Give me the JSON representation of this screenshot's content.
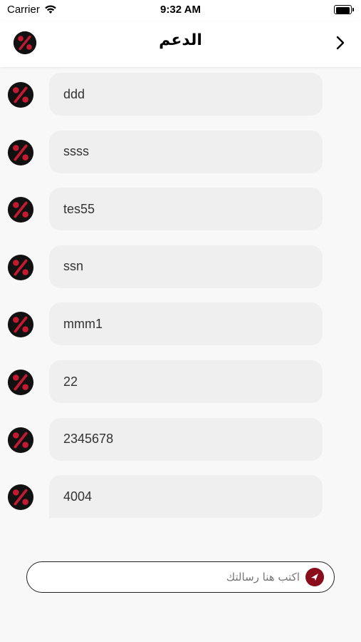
{
  "status_bar": {
    "carrier": "Carrier",
    "time": "9:32 AM"
  },
  "header": {
    "title": "الدعم"
  },
  "messages": [
    {
      "text": "ddd"
    },
    {
      "text": "ssss"
    },
    {
      "text": "tes55"
    },
    {
      "text": "ssn"
    },
    {
      "text": "mmm1"
    },
    {
      "text": "22"
    },
    {
      "text": "2345678"
    },
    {
      "text": "4004"
    }
  ],
  "composer": {
    "placeholder": "اكتب هنا رسالتك"
  },
  "colors": {
    "accent": "#8b0d1c",
    "bubble": "#efefef",
    "logo_bg": "#111111"
  },
  "icons": {
    "logo": "percent-logo-icon",
    "back": "chevron-right-icon",
    "send": "send-icon",
    "wifi": "wifi-icon",
    "battery": "battery-icon"
  }
}
